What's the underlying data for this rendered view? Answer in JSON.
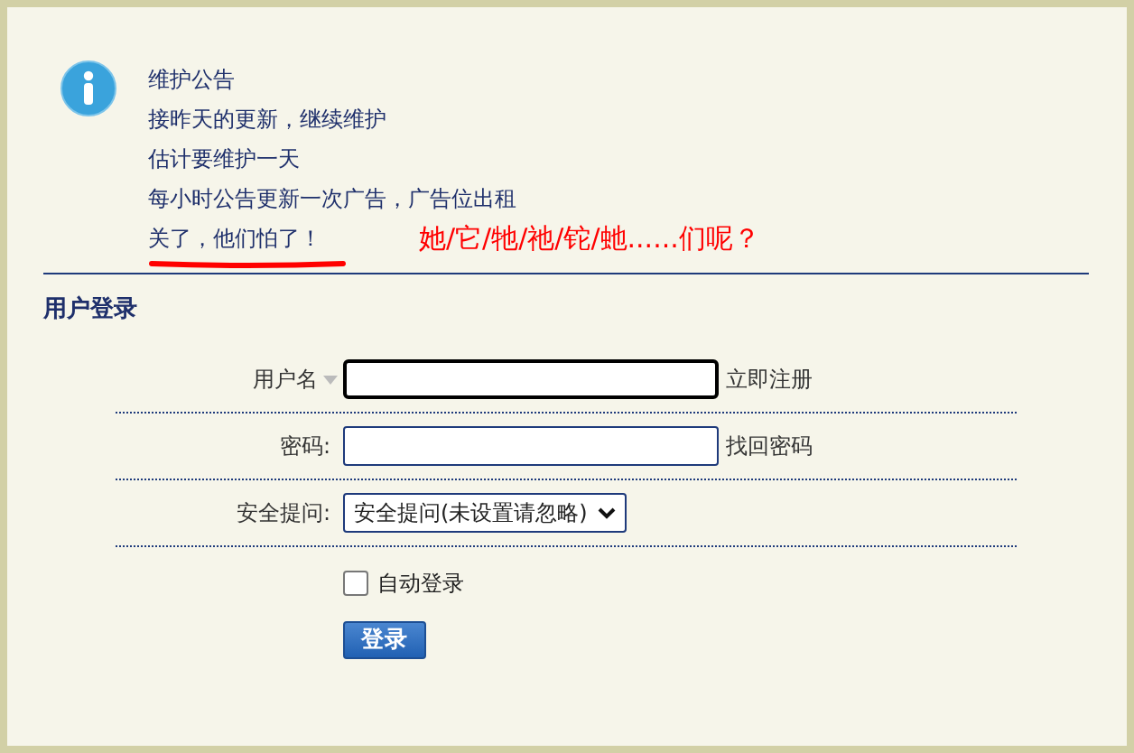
{
  "notice": {
    "title": "维护公告",
    "lines": [
      "接昨天的更新，继续维护",
      "估计要维护一天",
      "每小时公告更新一次广告，广告位出租"
    ],
    "highlight": "关了，他们怕了！",
    "annotation": "她/它/牠/祂/铊/虵......们呢？"
  },
  "login": {
    "title": "用户登录",
    "fields": [
      {
        "kind": "text",
        "label": "用户名",
        "has_caret": true,
        "focused": true,
        "link": "立即注册"
      },
      {
        "kind": "password",
        "label": "密码:",
        "has_caret": false,
        "focused": false,
        "link": "找回密码"
      },
      {
        "kind": "select",
        "label": "安全提问:",
        "has_caret": false,
        "focused": false,
        "value": "安全提问(未设置请忽略)"
      }
    ],
    "remember": {
      "label": "自动登录",
      "checked": false
    },
    "submit": "登录"
  }
}
